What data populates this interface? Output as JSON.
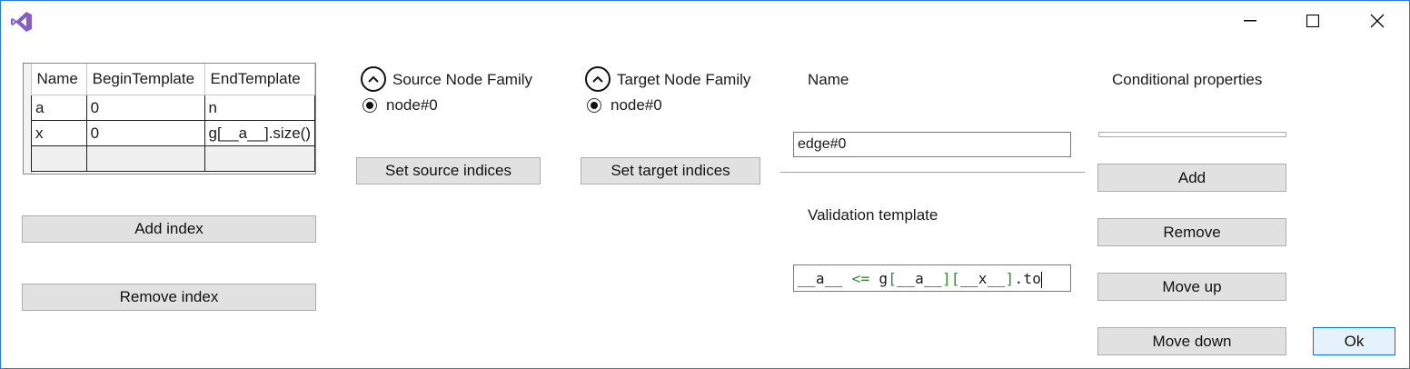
{
  "window": {
    "app_icon": "visual-studio-icon",
    "minimize_icon": "minimize-icon",
    "maximize_icon": "maximize-icon",
    "close_icon": "close-icon"
  },
  "indices": {
    "columns": [
      "Name",
      "BeginTemplate",
      "EndTemplate"
    ],
    "rows": [
      [
        "a",
        "0",
        "n"
      ],
      [
        "x",
        "0",
        "g[__a__].size()"
      ],
      [
        "",
        "",
        ""
      ]
    ],
    "add_label": "Add index",
    "remove_label": "Remove index"
  },
  "source": {
    "title": "Source Node Family",
    "option": "node#0",
    "button": "Set source indices"
  },
  "target": {
    "title": "Target Node Family",
    "option": "node#0",
    "button": "Set target indices"
  },
  "edge": {
    "name_label": "Name",
    "name_value": "edge#0",
    "validation_label": "Validation template",
    "validation_parts": [
      "__a__",
      " <= ",
      "g",
      "[",
      "__a__",
      "]",
      "[",
      "__x__",
      "]",
      ".to"
    ]
  },
  "conditional": {
    "title": "Conditional properties",
    "add_label": "Add",
    "remove_label": "Remove",
    "move_up_label": "Move up",
    "move_down_label": "Move down"
  },
  "ok_label": "Ok"
}
